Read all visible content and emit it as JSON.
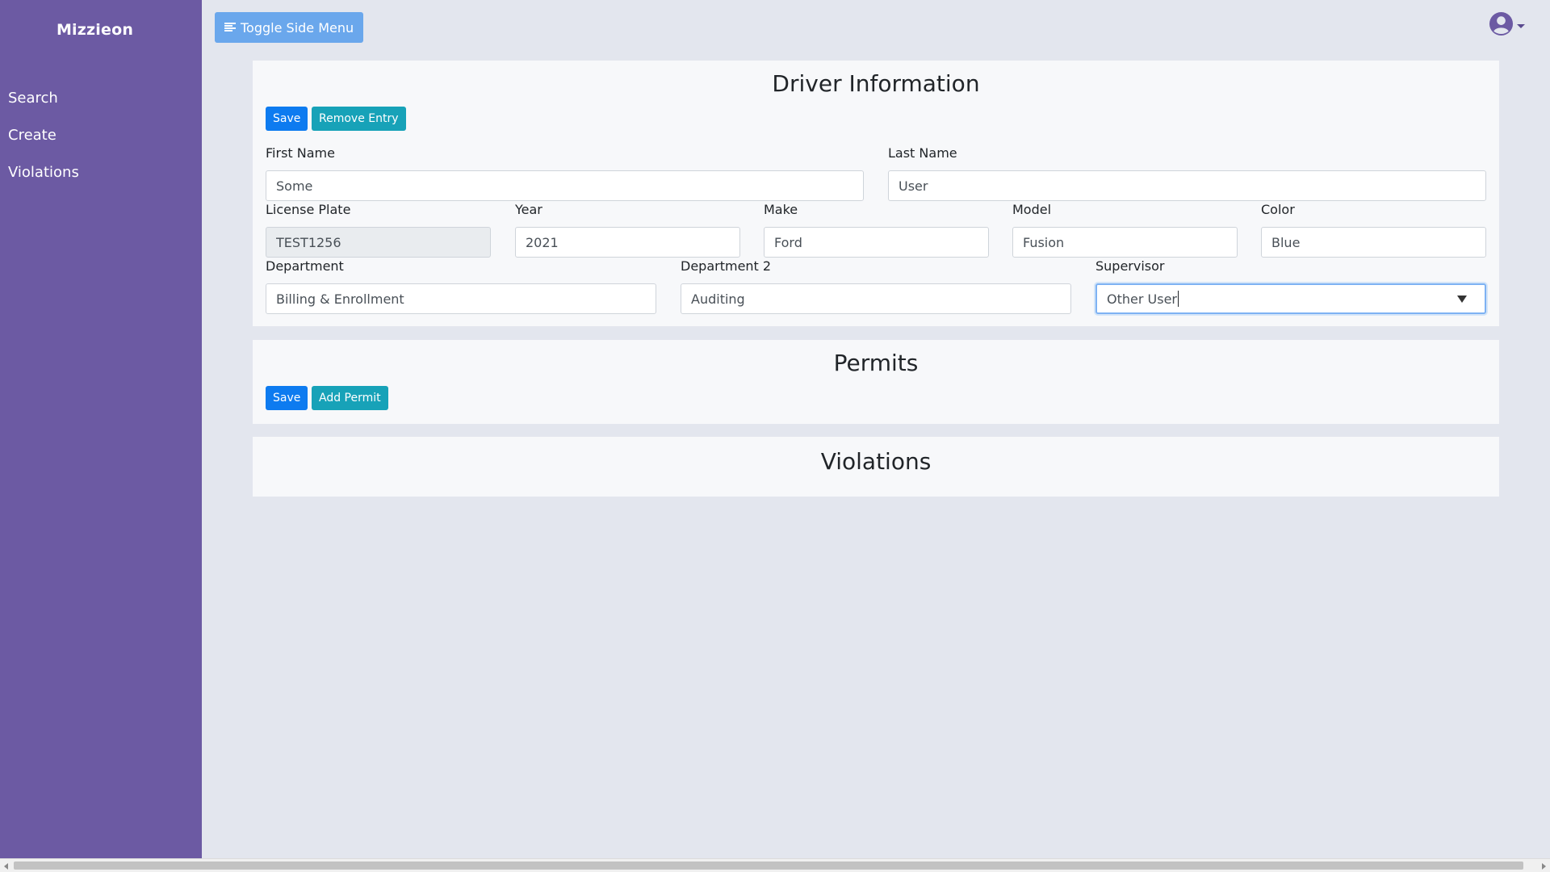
{
  "sidebar": {
    "brand": "Mizzieon",
    "items": [
      {
        "label": "Search"
      },
      {
        "label": "Create"
      },
      {
        "label": "Violations"
      }
    ]
  },
  "topbar": {
    "toggle_label": "Toggle Side Menu",
    "toggle_icon": "menu-lines-icon",
    "user_icon": "user-circle-icon"
  },
  "driver": {
    "title": "Driver Information",
    "save_label": "Save",
    "remove_label": "Remove Entry",
    "fields": {
      "first_name": {
        "label": "First Name",
        "value": "Some"
      },
      "last_name": {
        "label": "Last Name",
        "value": "User"
      },
      "license_plate": {
        "label": "License Plate",
        "value": "TEST1256"
      },
      "year": {
        "label": "Year",
        "value": "2021"
      },
      "make": {
        "label": "Make",
        "value": "Ford"
      },
      "model": {
        "label": "Model",
        "value": "Fusion"
      },
      "color": {
        "label": "Color",
        "value": "Blue"
      },
      "department": {
        "label": "Department",
        "value": "Billing & Enrollment"
      },
      "department2": {
        "label": "Department 2",
        "value": "Auditing"
      },
      "supervisor": {
        "label": "Supervisor",
        "value": "Other User"
      }
    }
  },
  "permits": {
    "title": "Permits",
    "save_label": "Save",
    "add_label": "Add Permit"
  },
  "violations": {
    "title": "Violations"
  },
  "colors": {
    "sidebar_bg": "#6c5aa3",
    "primary": "#0d7bf0",
    "info": "#17a2b8",
    "toggle_bg": "#6aa7ec",
    "page_bg": "#e3e6ee"
  }
}
